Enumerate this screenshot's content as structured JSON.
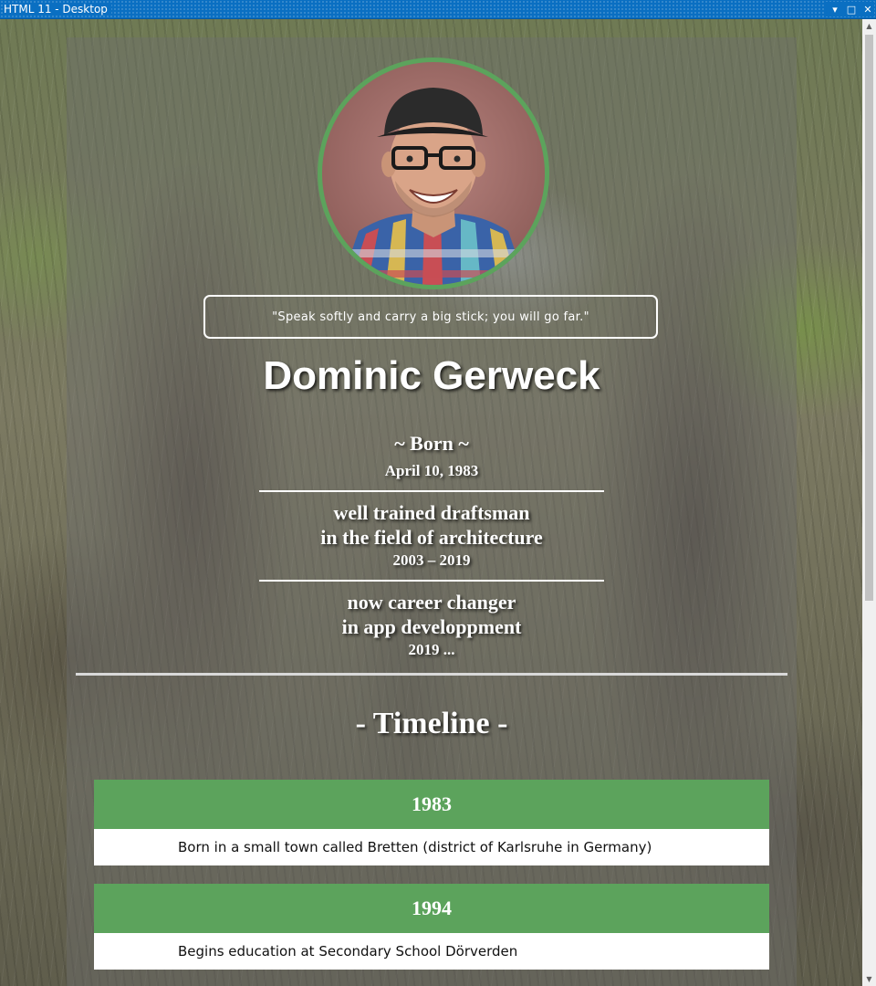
{
  "window": {
    "title": "HTML 11 - Desktop",
    "controls": {
      "dropdown": "▾",
      "maximize": "□",
      "close": "✕"
    }
  },
  "profile": {
    "quote": "\"Speak softly and carry a big stick; you will go far.\"",
    "name": "Dominic Gerweck",
    "born_label": "~ Born ~",
    "born_date": "April 10, 1983",
    "career_past_line1": "well trained draftsman",
    "career_past_line2": "in the field of architecture",
    "career_past_years": "2003 – 2019",
    "career_now_line1": "now career changer",
    "career_now_line2": "in app developpment",
    "career_now_years": "2019 ..."
  },
  "timeline": {
    "title": "- Timeline -",
    "entries": [
      {
        "year": "1983",
        "text": "Born in a small town called Bretten (district of Karlsruhe in Germany)"
      },
      {
        "year": "1994",
        "text": "Begins education at Secondary School Dörverden"
      }
    ]
  },
  "colors": {
    "accent_green": "#5ca35c",
    "titlebar_blue": "#0a6fc2"
  }
}
